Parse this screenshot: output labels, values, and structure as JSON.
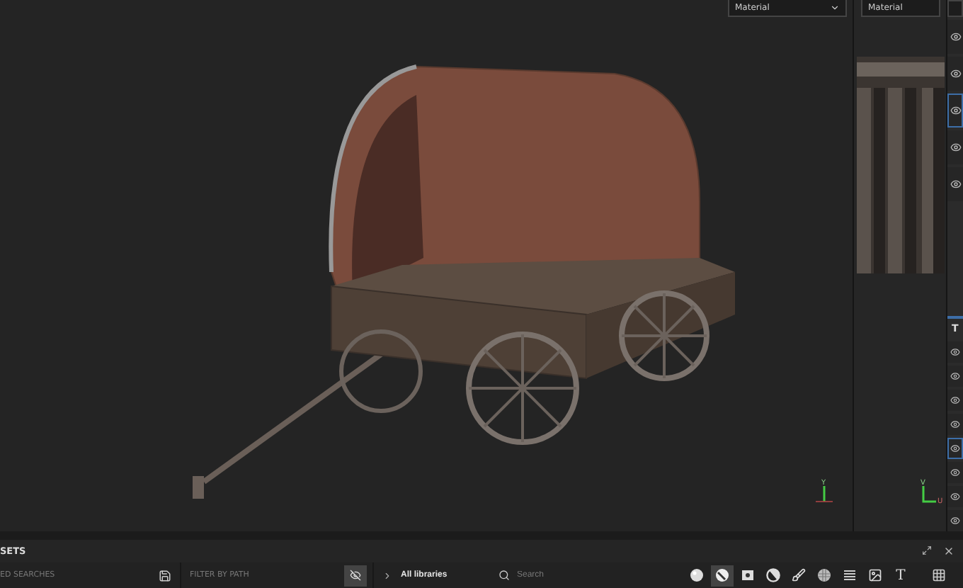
{
  "viewport_3d": {
    "material_dropdown": "Material",
    "gizmo_label": "Y"
  },
  "viewport_2d": {
    "material_dropdown": "Material",
    "gizmo_labels": [
      "V",
      "U"
    ]
  },
  "layer_columns": [
    {
      "items": [
        {
          "selected": false
        },
        {
          "selected": false
        },
        {
          "selected": true
        },
        {
          "selected": false
        },
        {
          "selected": false
        }
      ]
    },
    {
      "title": "T",
      "items": [
        {
          "selected": false
        },
        {
          "selected": false
        },
        {
          "selected": false
        },
        {
          "selected": false
        },
        {
          "selected": true
        },
        {
          "selected": false
        },
        {
          "selected": false
        },
        {
          "selected": false
        }
      ]
    }
  ],
  "assets_panel": {
    "title": "SETS",
    "saved_searches": "ED SEARCHES",
    "filter_placeholder": "FILTER BY PATH",
    "library": "All libraries",
    "search_placeholder": "Search",
    "filters": [
      {
        "kind": "sphere",
        "selected": false
      },
      {
        "kind": "material",
        "selected": true
      },
      {
        "kind": "square",
        "selected": false
      },
      {
        "kind": "half",
        "selected": false
      },
      {
        "kind": "brush",
        "selected": false
      },
      {
        "kind": "pattern",
        "selected": false
      },
      {
        "kind": "lines",
        "selected": false
      },
      {
        "kind": "image",
        "selected": false
      },
      {
        "kind": "text",
        "label": "T",
        "selected": false
      }
    ]
  }
}
